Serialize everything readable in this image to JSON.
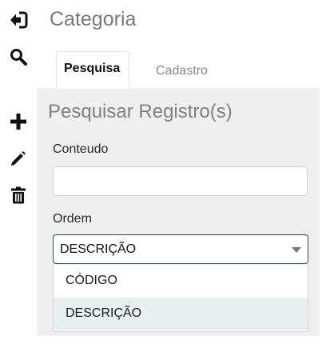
{
  "header": {
    "title": "Categoria"
  },
  "toolbar": {
    "items": [
      {
        "icon": "back-icon"
      },
      {
        "icon": "search-icon"
      },
      {
        "icon": "plus-icon"
      },
      {
        "icon": "pencil-icon"
      },
      {
        "icon": "trash-icon"
      }
    ]
  },
  "tabs": [
    {
      "label": "Pesquisa",
      "active": true
    },
    {
      "label": "Cadastro",
      "active": false
    }
  ],
  "search_panel": {
    "title": "Pesquisar Registro(s)",
    "conteudo_label": "Conteudo",
    "conteudo_value": "",
    "ordem_label": "Ordem",
    "ordem_selected": "DESCRIÇÃO",
    "ordem_options": [
      "CÓDIGO",
      "DESCRIÇÃO"
    ],
    "highlighted_option_index": 1
  },
  "colors": {
    "panel_bg": "#efefef",
    "select_border": "#2f4f4f",
    "option_highlight": "#e9efee",
    "title_text": "#7a7a7a"
  }
}
